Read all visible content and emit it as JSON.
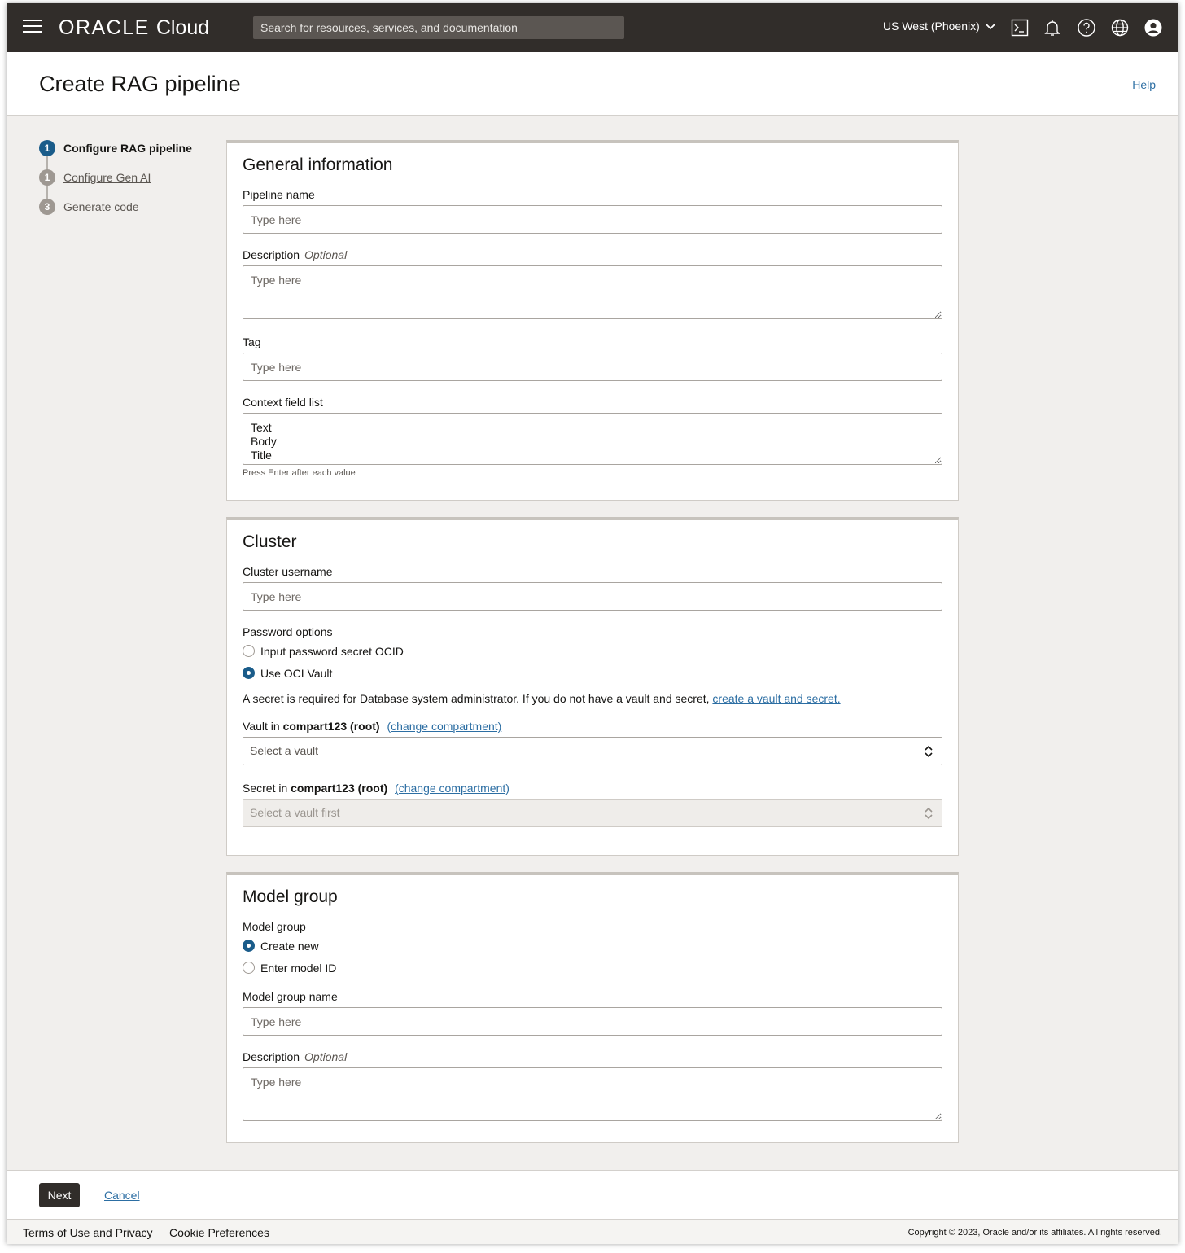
{
  "header": {
    "brand_oracle": "ORACLE",
    "brand_cloud": "Cloud",
    "search_placeholder": "Search for resources, services, and documentation",
    "region": "US West (Phoenix)"
  },
  "page": {
    "title": "Create RAG pipeline",
    "help": "Help"
  },
  "steps": [
    {
      "number": "1",
      "label": "Configure RAG pipeline",
      "active": true
    },
    {
      "number": "1",
      "label": "Configure Gen AI",
      "active": false
    },
    {
      "number": "3",
      "label": "Generate code",
      "active": false
    }
  ],
  "general": {
    "heading": "General information",
    "pipeline_name_label": "Pipeline name",
    "pipeline_name_placeholder": "Type here",
    "description_label": "Description",
    "optional": "Optional",
    "description_placeholder": "Type here",
    "tag_label": "Tag",
    "tag_placeholder": "Type here",
    "context_label": "Context field list",
    "context_value": "Text\nBody\nTitle",
    "context_hint": "Press Enter after each value"
  },
  "cluster": {
    "heading": "Cluster",
    "username_label": "Cluster username",
    "username_placeholder": "Type here",
    "password_label": "Password options",
    "option_secret": "Input password secret OCID",
    "option_vault": "Use OCI Vault",
    "secret_note": "A secret is required for Database system administrator. If you do not have a vault and secret,",
    "secret_link": "create a vault and secret.",
    "vault_prefix": "Vault in",
    "vault_compartment": "compart123 (root)",
    "change_compartment": "(change compartment)",
    "vault_select": "Select a vault",
    "secret_prefix": "Secret in",
    "secret_compartment": "compart123 (root)",
    "secret_select": "Select a vault first"
  },
  "model": {
    "heading": "Model group",
    "group_label": "Model group",
    "option_create": "Create new",
    "option_enter": "Enter model ID",
    "name_label": "Model group name",
    "name_placeholder": "Type here",
    "description_label": "Description",
    "optional": "Optional",
    "description_placeholder": "Type here"
  },
  "actions": {
    "next": "Next",
    "cancel": "Cancel"
  },
  "footer": {
    "terms": "Terms of Use and Privacy",
    "cookies": "Cookie Preferences",
    "copyright": "Copyright © 2023, Oracle and/or its affiliates. All rights reserved."
  },
  "colors": {
    "header_bg": "#312d2a",
    "accent": "#1a5c8a",
    "link": "#2c6ea3",
    "page_bg": "#f1efed"
  },
  "icons": [
    "menu-icon",
    "chevron-down-icon",
    "cloud-shell-icon",
    "bell-icon",
    "help-icon",
    "globe-icon",
    "user-profile-icon",
    "up-down-chevron-icon"
  ]
}
